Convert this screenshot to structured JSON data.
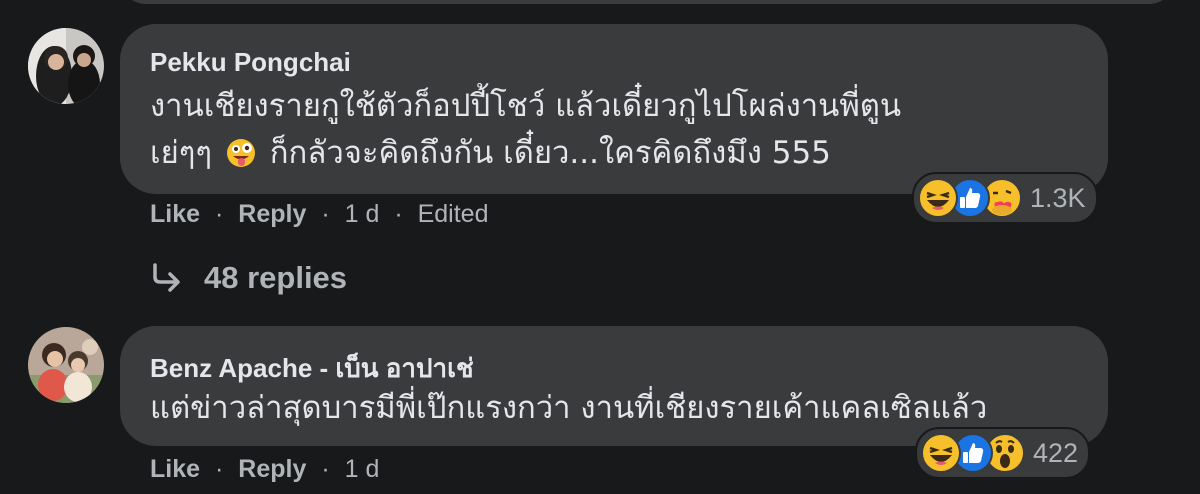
{
  "comments": [
    {
      "author": "Pekku Pongchai",
      "text_line1": "งานเชียงรายกูใช้ตัวก็อปปี้โชว์ แล้วเดี๋ยวกูไปโผล่งานพี่ตูน",
      "text_line2_a": "เย่ๆๆ",
      "text_line2_b": "ก็กลัวจะคิดถึงกัน เดี๋ยว...ใครคิดถึงมึง 555",
      "reaction_count": "1.3K",
      "like_label": "Like",
      "reply_label": "Reply",
      "time": "1 d",
      "edited_label": "Edited",
      "reactions": [
        "haha-icon",
        "like-icon",
        "care-icon"
      ],
      "inline_emoji": "zany-face-icon"
    },
    {
      "author": "Benz Apache - เบ็น อาปาเช่",
      "text_line1": "แต่ข่าวล่าสุดบารมีพี่เป๊กแรงกว่า งานที่เชียงรายเค้าแคลเซิลแล้ว",
      "reaction_count": "422",
      "like_label": "Like",
      "reply_label": "Reply",
      "time": "1 d",
      "reactions": [
        "haha-icon",
        "like-icon",
        "wow-icon"
      ]
    }
  ],
  "replies": {
    "label": "48 replies",
    "icon": "reply-arrow-icon"
  },
  "separator": "·"
}
